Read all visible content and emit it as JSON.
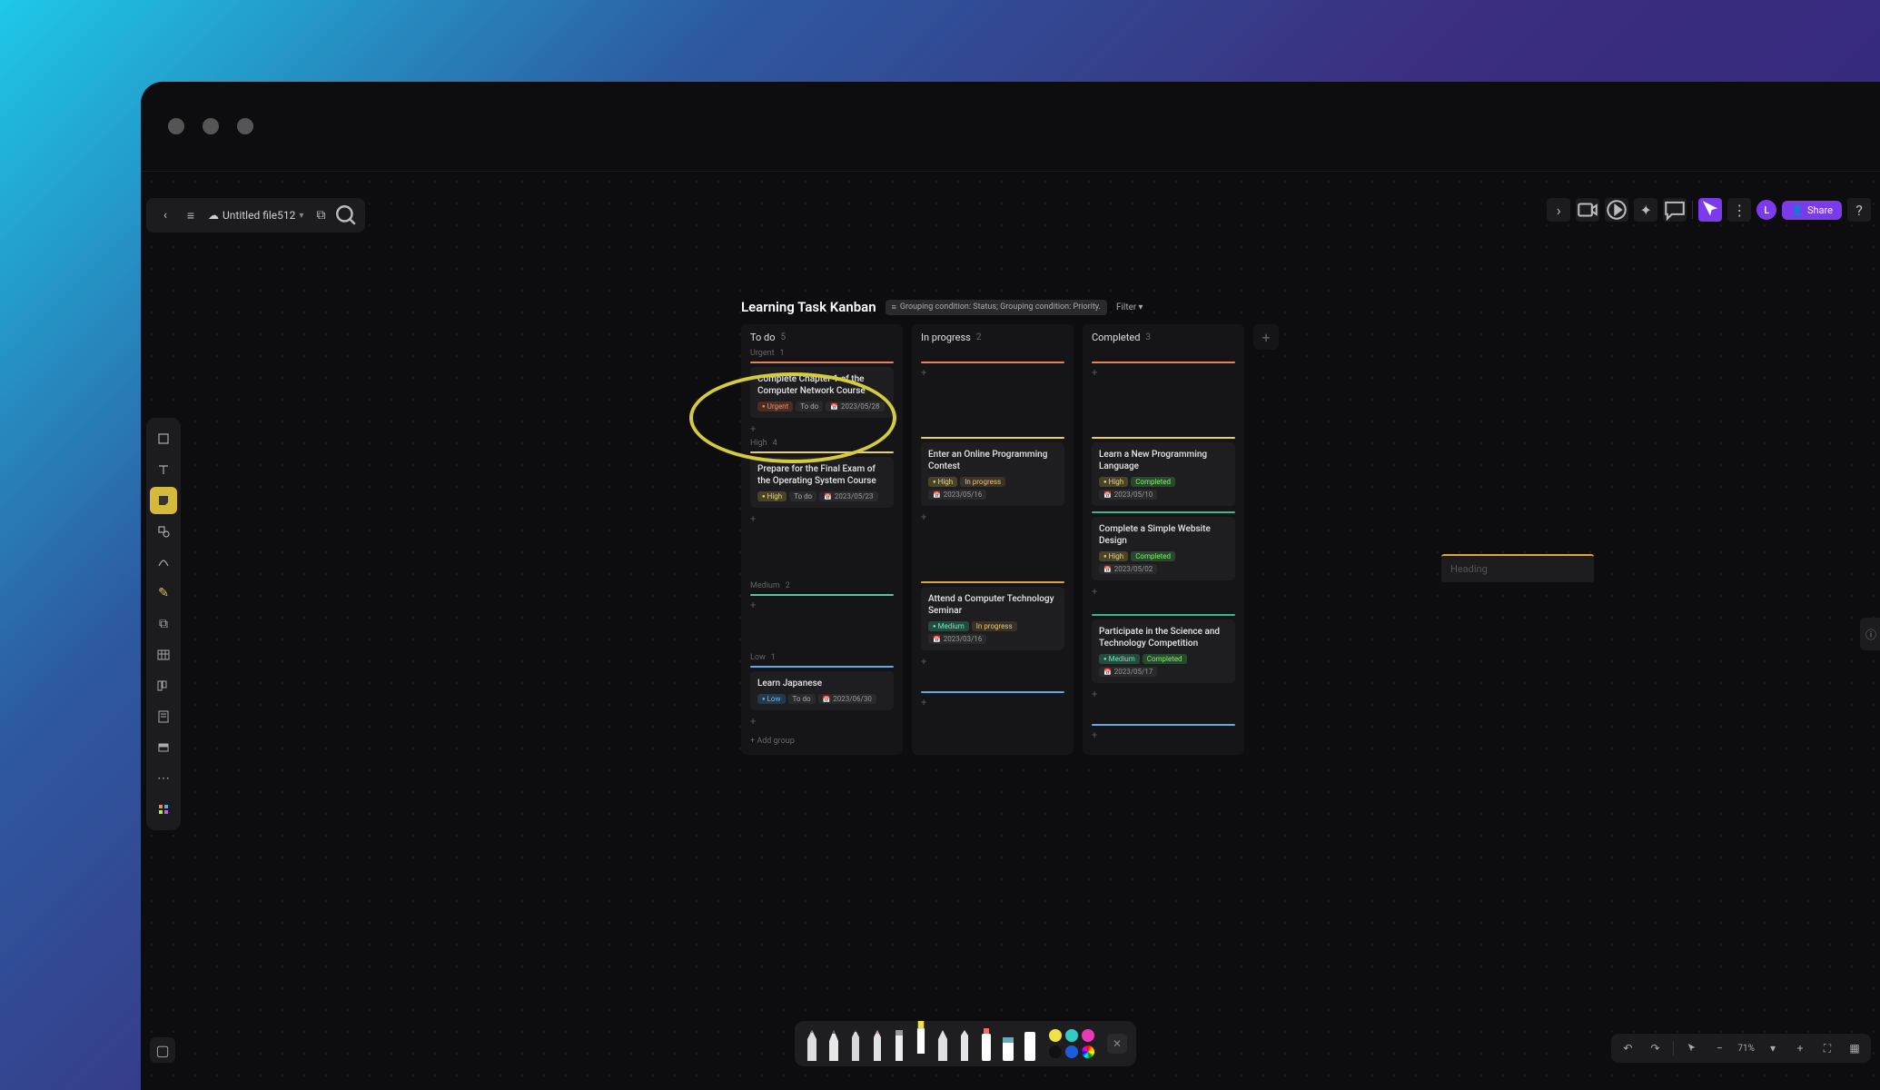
{
  "file": {
    "title": "Untitled file512"
  },
  "top_icons": {
    "back": "‹",
    "menu": "≡",
    "cloud": "☁",
    "doc": "⧉",
    "search": "🔍"
  },
  "top_right": {
    "avatar_initial": "L",
    "share": "Share"
  },
  "kanban": {
    "title": "Learning Task Kanban",
    "conditions": "Grouping condition: Status; Grouping condition: Priority.",
    "filter_label": "Filter",
    "columns": [
      {
        "name": "To do",
        "count": "5"
      },
      {
        "name": "In progress",
        "count": "2"
      },
      {
        "name": "Completed",
        "count": "3"
      }
    ],
    "groups": {
      "urgent": {
        "label": "Urgent",
        "count": "1"
      },
      "high": {
        "label": "High",
        "count": "4"
      },
      "medium": {
        "label": "Medium",
        "count": "2"
      },
      "low": {
        "label": "Low",
        "count": "1"
      }
    },
    "add_group": "Add group",
    "cards": {
      "c1": {
        "title": "Complete Chapter 1 of the Computer Network Course",
        "priority": "Urgent",
        "status": "To do",
        "date": "2023/05/28"
      },
      "c2": {
        "title": "Prepare for the Final Exam of the Operating System Course",
        "priority": "High",
        "status": "To do",
        "date": "2023/05/23"
      },
      "c3": {
        "title": "Enter an Online Programming Contest",
        "priority": "High",
        "status": "In progress",
        "date": "2023/05/16"
      },
      "c4": {
        "title": "Learn a New Programming Language",
        "priority": "High",
        "status": "Completed",
        "date": "2023/05/10"
      },
      "c5": {
        "title": "Complete a Simple Website Design",
        "priority": "High",
        "status": "Completed",
        "date": "2023/05/02"
      },
      "c6": {
        "title": "Attend a Computer Technology Seminar",
        "priority": "Medium",
        "status": "In progress",
        "date": "2023/03/16"
      },
      "c7": {
        "title": "Participate in the Science and Technology Competition",
        "priority": "Medium",
        "status": "Completed",
        "date": "2023/05/17"
      },
      "c8": {
        "title": "Learn Japanese",
        "priority": "Low",
        "status": "To do",
        "date": "2023/06/30"
      }
    }
  },
  "pens": {
    "colors": [
      "#f0e244",
      "#33c9c9",
      "#e83ab8",
      "#111111",
      "#1a5edb",
      "#ff8c3a"
    ],
    "rainbow": "conic-gradient(red,orange,yellow,green,cyan,blue,magenta,red)"
  },
  "heading_placeholder": "Heading",
  "zoom": "71%"
}
